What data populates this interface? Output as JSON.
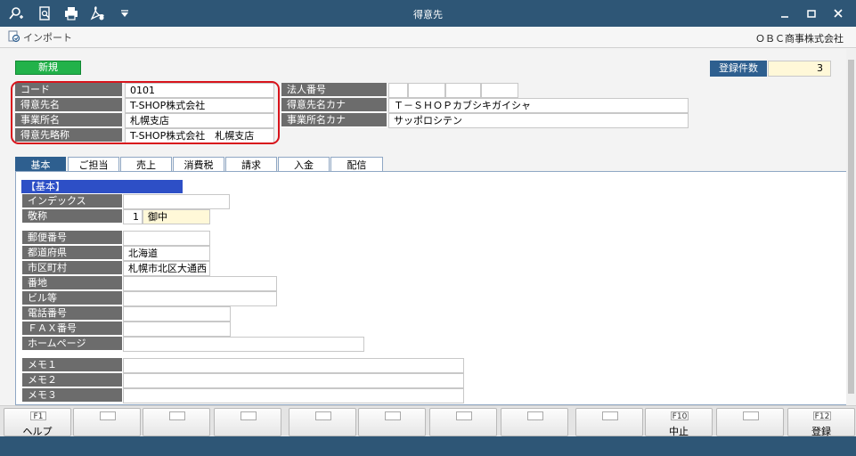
{
  "window": {
    "title": "得意先"
  },
  "toolbar": {
    "import_label": "インポート",
    "company": "ＯＢＣ商事株式会社"
  },
  "status": {
    "mode": "新規",
    "count_label": "登録件数",
    "count_value": "3"
  },
  "header_fields": {
    "code_label": "コード",
    "code_value": "0101",
    "name_label": "得意先名",
    "name_value": "T-SHOP株式会社",
    "office_label": "事業所名",
    "office_value": "札幌支店",
    "short_label": "得意先略称",
    "short_value": "T-SHOP株式会社　札幌支店",
    "corp_label": "法人番号",
    "kana_label": "得意先名カナ",
    "kana_value": "Ｔ－ＳＨＯＰカブシキガイシャ",
    "office_kana_label": "事業所名カナ",
    "office_kana_value": "サッポロシテン"
  },
  "tabs": [
    "基本",
    "ご担当",
    "売上",
    "消費税",
    "請求",
    "入金",
    "配信"
  ],
  "basic": {
    "section_title": "【基本】",
    "index_label": "インデックス",
    "honorific_label": "敬称",
    "honorific_code": "1",
    "honorific_value": "御中",
    "postal_label": "郵便番号",
    "pref_label": "都道府県",
    "pref_value": "北海道",
    "city_label": "市区町村",
    "city_value": "札幌市北区大通西",
    "address_label": "番地",
    "building_label": "ビル等",
    "phone_label": "電話番号",
    "fax_label": "ＦＡＸ番号",
    "homepage_label": "ホームページ",
    "memo1_label": "メモ１",
    "memo2_label": "メモ２",
    "memo3_label": "メモ３"
  },
  "fkeys": {
    "f1_num": "F1",
    "f1_label": "ヘルプ",
    "f10_num": "F10",
    "f10_label": "中止",
    "f12_num": "F12",
    "f12_label": "登録"
  }
}
